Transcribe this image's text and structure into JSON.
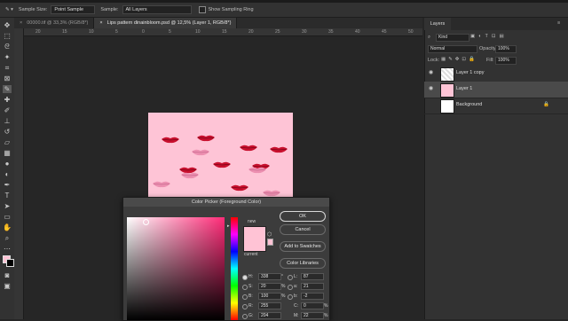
{
  "options_bar": {
    "sample_size_label": "Sample Size:",
    "sample_size_value": "Point Sample",
    "sample_label": "Sample:",
    "sample_value": "All Layers",
    "show_ring_label": "Show Sampling Ring"
  },
  "tabs": [
    {
      "label": "00000.tif @ 33,3% (RGB/8*)"
    },
    {
      "label": "Lips pattern dinainbloom.psd @ 12,5% (Layer 1, RGB/8*)"
    }
  ],
  "ruler": {
    "ticks": [
      "20",
      "15",
      "10",
      "5",
      "0",
      "5",
      "10",
      "15",
      "20",
      "25",
      "30",
      "35",
      "40",
      "45",
      "50"
    ]
  },
  "layers_panel": {
    "title": "Layers",
    "kind_label": "Kind",
    "blend_mode": "Normal",
    "opacity_label": "Opacity:",
    "opacity_value": "100%",
    "lock_label": "Lock:",
    "fill_label": "Fill:",
    "fill_value": "100%",
    "layers": [
      {
        "name": "Layer 1 copy"
      },
      {
        "name": "Layer 1"
      },
      {
        "name": "Background"
      }
    ]
  },
  "color_picker": {
    "title": "Color Picker (Foreground Color)",
    "ok_label": "OK",
    "cancel_label": "Cancel",
    "add_swatches_label": "Add to Swatches",
    "color_libraries_label": "Color Libraries",
    "new_label": "new",
    "current_label": "current",
    "new_color": "#ffc3d5",
    "fields": {
      "H": {
        "label": "H:",
        "value": "338",
        "unit": "°"
      },
      "S": {
        "label": "S:",
        "value": "20",
        "unit": "%"
      },
      "B": {
        "label": "B:",
        "value": "100",
        "unit": "%"
      },
      "R": {
        "label": "R:",
        "value": "255"
      },
      "G": {
        "label": "G:",
        "value": "204"
      },
      "L": {
        "label": "L:",
        "value": "87"
      },
      "a": {
        "label": "a:",
        "value": "21"
      },
      "b": {
        "label": "b:",
        "value": "-2"
      },
      "C": {
        "label": "C:",
        "value": "0",
        "unit": "%"
      },
      "M": {
        "label": "M:",
        "value": "22",
        "unit": "%"
      }
    }
  },
  "colors": {
    "canvas": "#fec4d6",
    "lips": "#c8102e"
  }
}
